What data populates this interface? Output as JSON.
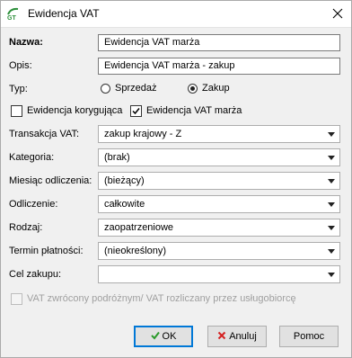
{
  "window": {
    "title": "Ewidencja VAT",
    "close_icon": "close-icon"
  },
  "form": {
    "nazwa": {
      "label": "Nazwa:",
      "value": "Ewidencja VAT marża"
    },
    "opis": {
      "label": "Opis:",
      "value": "Ewidencja VAT marża - zakup"
    },
    "typ": {
      "label": "Typ:",
      "options": [
        "Sprzedaż",
        "Zakup"
      ],
      "selected": "Zakup"
    },
    "korygujaca": {
      "label": "Ewidencja korygująca",
      "checked": false
    },
    "marza": {
      "label": "Ewidencja VAT marża",
      "checked": true
    },
    "transakcja": {
      "label": "Transakcja VAT:",
      "value": "zakup krajowy - Z"
    },
    "kategoria": {
      "label": "Kategoria:",
      "value": "(brak)"
    },
    "miesiac": {
      "label": "Miesiąc odliczenia:",
      "value": "(bieżący)"
    },
    "odliczenie": {
      "label": "Odliczenie:",
      "value": "całkowite"
    },
    "rodzaj": {
      "label": "Rodzaj:",
      "value": "zaopatrzeniowe"
    },
    "termin": {
      "label": "Termin płatności:",
      "value": "(nieokreślony)"
    },
    "cel": {
      "label": "Cel zakupu:",
      "value": ""
    },
    "vat_zwrocony": {
      "label": "VAT zwrócony podróżnym/ VAT rozliczany przez usługobiorcę",
      "checked": false,
      "enabled": false
    }
  },
  "buttons": {
    "ok": {
      "label": "OK",
      "icon": "ok-check-icon"
    },
    "cancel": {
      "label": "Anuluj",
      "icon": "cancel-x-icon"
    },
    "help": {
      "label": "Pomoc"
    }
  },
  "colors": {
    "ok_icon": "#2a9a2a",
    "cancel_icon": "#d42020",
    "default_button_border": "#0078d7"
  }
}
